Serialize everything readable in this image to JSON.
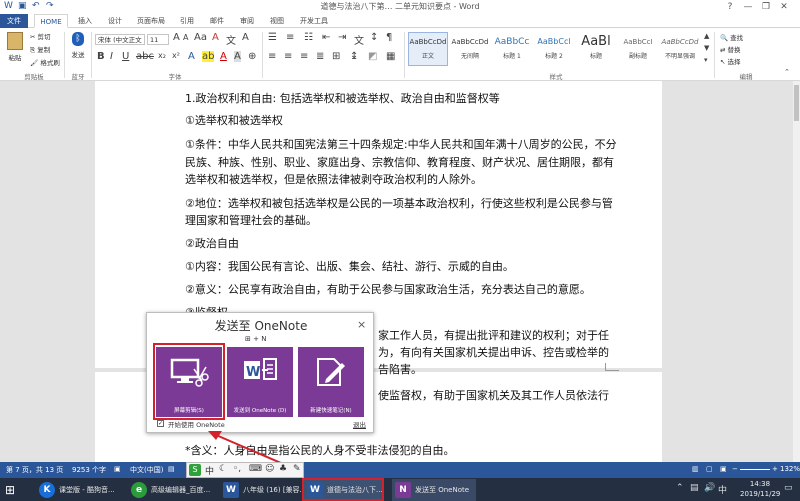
{
  "window": {
    "title": "道德与法治八下第… 二单元知识要点 - Word",
    "help": "?",
    "minimize": "—",
    "restore": "❐",
    "close": "✕"
  },
  "tabs": [
    "文件",
    "HOME",
    "插入",
    "设计",
    "页面布局",
    "引用",
    "邮件",
    "审阅",
    "视图",
    "开发工具"
  ],
  "ribbon": {
    "clipboard": {
      "paste": "粘贴",
      "cut": "剪切",
      "copy": "复制",
      "format_painter": "格式刷",
      "label": "剪贴板"
    },
    "bluetooth": {
      "send": "发送",
      "label": "蓝牙"
    },
    "font": {
      "name": "宋体 (中文正文",
      "size": "11",
      "label": "字体"
    },
    "styles": {
      "label": "样式",
      "items": [
        {
          "preview": "AaBbCcDd",
          "name": "正文"
        },
        {
          "preview": "AaBbCcDd",
          "name": "无间隔"
        },
        {
          "preview": "AaBbCc",
          "name": "标题 1"
        },
        {
          "preview": "AaBbCcl",
          "name": "标题 2"
        },
        {
          "preview": "AaBl",
          "name": "标题"
        },
        {
          "preview": "AaBbCcI",
          "name": "副标题"
        },
        {
          "preview": "AaBbCcDd",
          "name": "不明显强调"
        }
      ]
    },
    "editing": {
      "find": "查找",
      "replace": "替换",
      "select": "选择",
      "label": "编辑"
    }
  },
  "document": {
    "lines": [
      "1.政治权利和自由: 包括选举权和被选举权、政治自由和监督权等",
      "①选举权和被选举权",
      "①条件：中华人民共和国宪法第三十四条规定:中华人民共和国年满十八周岁的公民，不分",
      "民族、种族、性别、职业、家庭出身、宗教信仰、教育程度、财产状况、居住期限，都有",
      "选举权和被选举权，但是依照法律被剥夺政治权利的人除外。",
      "②地位：选举权和被包括选举权是公民的一项基本政治权利，行使这些权利是公民参与管",
      "理国家和管理社会的基础。",
      "②政治自由",
      "①内容：我国公民有言论、出版、集会、结社、游行、示威的自由。",
      "②意义：公民享有政治自由，有助于公民参与国家政治生活，充分表达自己的意愿。",
      "③监督权",
      "家工作人员，有提出批评和建议的权利；对于任",
      "为，有向有关国家机关提出申诉、控告或检举的",
      "告陷害。",
      "使监督权，有助于国家机关及其工作人员依法行",
      "*含义：人身自由是指公民的人身不受非法侵犯的自由。"
    ]
  },
  "onenote_popup": {
    "title": "发送至 OneNote",
    "close": "×",
    "shortcut": "+ N",
    "tiles": [
      {
        "label": "屏幕剪辑(S)"
      },
      {
        "label": "发送到 OneNote (D)"
      },
      {
        "label": "新建快速笔记(N)"
      }
    ],
    "checkbox_label": "开始使用 OneNote",
    "exit": "退出"
  },
  "statusbar": {
    "page": "第 7 页，共 13 页",
    "words": "9253 个字",
    "lang": "中文(中国)",
    "zoom": "132%"
  },
  "taskbar": {
    "items": [
      {
        "label": "课堂版 - 酷狗音..."
      },
      {
        "label": "高级编辑器_百度..."
      },
      {
        "label": "八年级 (16) [兼容..."
      },
      {
        "label": "道德与法治八下..."
      },
      {
        "label": "发送至 OneNote"
      }
    ],
    "time": "14:38",
    "date": "2019/11/29"
  },
  "colors": {
    "accent": "#2b579a",
    "onenote": "#7b3a96",
    "highlight": "#d4212c",
    "taskbar": "#243042"
  }
}
